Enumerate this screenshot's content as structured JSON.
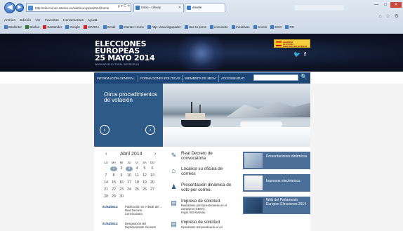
{
  "browser": {
    "url": "http://elecciones.interior.es/web/europeas2014/home",
    "addr_tools": "ρ ▾ C ✕",
    "tabs": [
      {
        "label": "Inicio - Liferay"
      },
      {
        "label": "envele"
      }
    ],
    "menu": [
      "Archivo",
      "Edición",
      "Ver",
      "Favoritos",
      "Herramientas",
      "Ayuda"
    ],
    "favorites": [
      "Bankinter",
      "Bankia",
      "Santander",
      "Google",
      "MARCA",
      "Gmail",
      "Interias: Home",
      "http--www.bigupader",
      "Haz tu porra",
      "comunete",
      "Iniciativas",
      "envele",
      "ECO",
      "RS"
    ],
    "window_buttons": {
      "min": "—",
      "max": "□",
      "close": "✕"
    },
    "toolbar_icons": "⌂ ☆ ⚙"
  },
  "site": {
    "logo": {
      "line1": "ELECCIONES",
      "line2": "EUROPEAS",
      "line3": "25 MAYO 2014",
      "url": "WWW.INFOELECTORAL.INTERIOR.ES"
    },
    "ministry": {
      "line1": "GOBIERNO",
      "line2": "DE ESPAÑA",
      "line3": "MINISTERIO DEL INTERIOR"
    },
    "social": {
      "twitter": "🐦",
      "facebook": "f"
    },
    "nav": [
      "INFORMACIÓN GENERAL",
      "FORMACIONES POLÍTICAS",
      "MIEMBROS DE MESA",
      "ACCESIBILIDAD"
    ],
    "search_icon": "🔍"
  },
  "slider": {
    "title": "Otros procedimientos de votación",
    "prev": "‹",
    "next": "›"
  },
  "calendar": {
    "prev": "‹",
    "month": "Abril 2014",
    "next": "›",
    "dow": [
      "LU",
      "MA",
      "MI",
      "JU",
      "VI",
      "SA",
      "DO"
    ],
    "weeks": [
      [
        "",
        "1",
        "2",
        "3",
        "4",
        "5",
        "6"
      ],
      [
        "7",
        "8",
        "9",
        "10",
        "11",
        "12",
        "13"
      ],
      [
        "14",
        "15",
        "16",
        "17",
        "18",
        "19",
        "20"
      ],
      [
        "21",
        "22",
        "23",
        "24",
        "25",
        "26",
        "27"
      ],
      [
        "28",
        "29",
        "30",
        "",
        "",
        "",
        ""
      ]
    ]
  },
  "news": [
    {
      "date": "01/04/2014:",
      "lines": [
        "Publicación en el BOE del ...",
        "Real Decreto",
        "Convocatoria"
      ]
    },
    {
      "date": "01/04/2014:",
      "lines": [
        "Designación del",
        "Representante General"
      ]
    }
  ],
  "links": [
    {
      "icon": "✎",
      "label": [
        "Real Decreto de",
        "convocatoria"
      ],
      "sub": []
    },
    {
      "icon": "⌂",
      "label": [
        "Localice su oficina de",
        "correos"
      ],
      "sub": []
    },
    {
      "icon": "♟",
      "label": [
        "Presentación dinámica de",
        "voto por correo."
      ],
      "sub": []
    },
    {
      "icon": "▤",
      "label": [
        "Impreso de solicitud."
      ],
      "sub": [
        "Residentes permanentemente en el",
        "extranjero (CERA).",
        "Hojas Informativas."
      ]
    },
    {
      "icon": "▤",
      "label": [
        "Impreso de solicitud"
      ],
      "sub": [
        "Residentes temporalmente en el"
      ]
    }
  ],
  "tiles": [
    {
      "label": "Presentaciones dinámicas"
    },
    {
      "label": "Impresos electrónicos"
    },
    {
      "label": "Web del Parlamento Europeo Elecciones 2014"
    }
  ]
}
